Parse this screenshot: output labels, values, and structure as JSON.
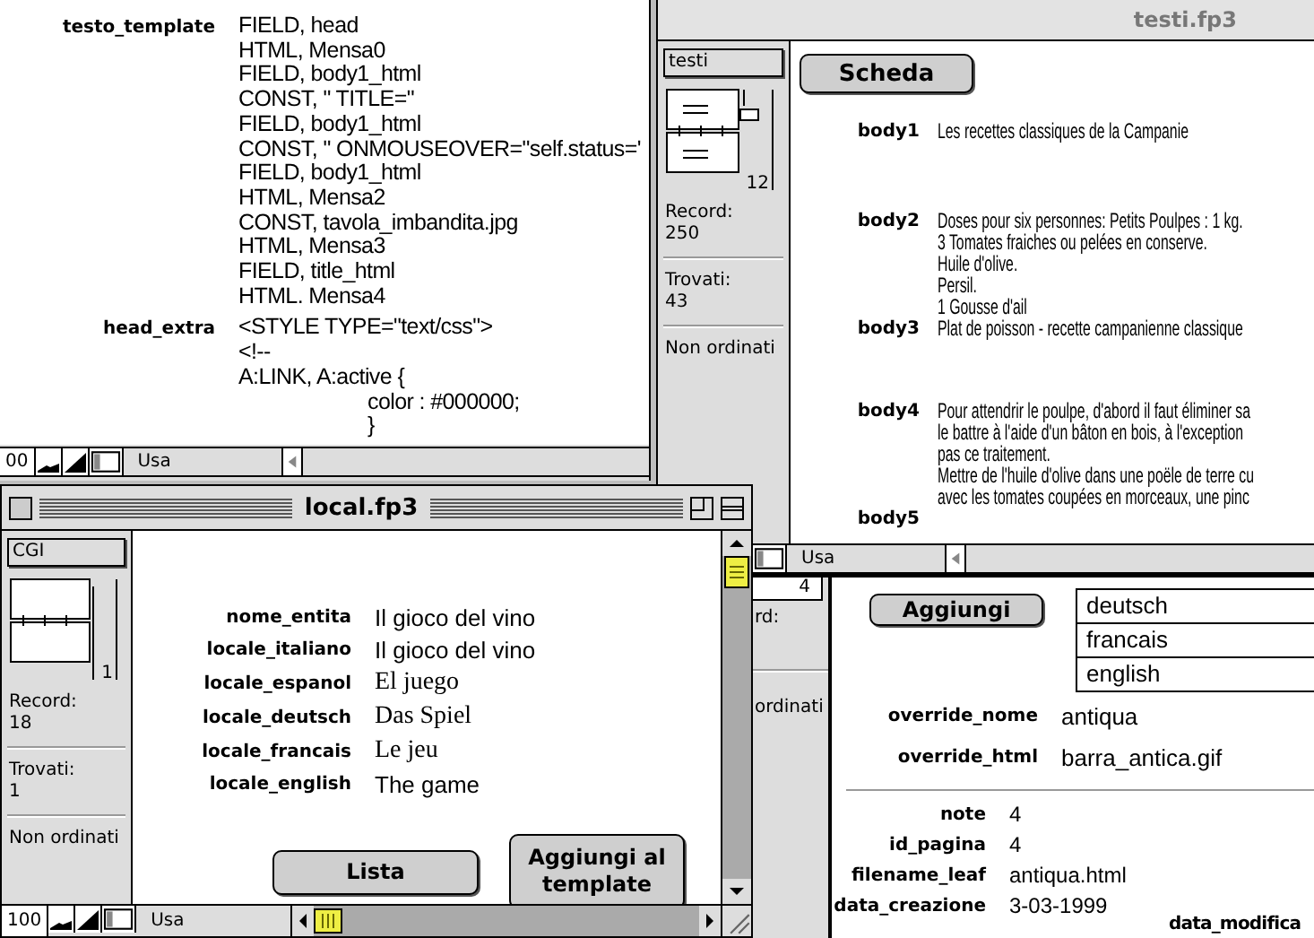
{
  "back_window": {
    "rows": [
      {
        "label": "testo_template",
        "lines": [
          {
            "text": "FIELD, head",
            "kind": "plain"
          },
          {
            "text": "HTML, Mensa0",
            "kind": "plain"
          },
          {
            "text": "FIELD, body1_html",
            "kind": "plain"
          },
          {
            "text": "CONST, \" TITLE=\"",
            "kind": "plain"
          },
          {
            "text": "FIELD, body1_html",
            "kind": "plain"
          },
          {
            "text": "CONST, \" ONMOUSEOVER=\"self.status='",
            "kind": "plain"
          },
          {
            "text": "FIELD, body1_html",
            "kind": "plain"
          },
          {
            "text": "HTML, Mensa2",
            "kind": "plain"
          },
          {
            "text": "CONST, tavola_imbandita.jpg",
            "kind": "plain"
          },
          {
            "text": "HTML, Mensa3",
            "kind": "plain"
          },
          {
            "text": "FIELD, title_html",
            "kind": "plain"
          },
          {
            "text": "HTML. Mensa4",
            "kind": "plain"
          }
        ]
      },
      {
        "label": "head_extra",
        "lines": [
          {
            "text": "<STYLE TYPE=\"text/css\">",
            "kind": "plain"
          },
          {
            "text": "<!--",
            "kind": "plain"
          },
          {
            "text": "A:LINK, A:active {",
            "kind": "plain"
          },
          {
            "text": "color : #000000;",
            "kind": "indented"
          },
          {
            "text": "}",
            "kind": "indented"
          }
        ]
      }
    ],
    "status_bar": {
      "zoom": "00",
      "mode": "Usa"
    }
  },
  "testi_window": {
    "title": "testi.fp3",
    "sidebar": {
      "layout": "testi",
      "page": "12",
      "record_label": "Record:",
      "record": "250",
      "found_label": "Trovati:",
      "found": "43",
      "sort": "Non ordinati"
    },
    "button": "Scheda",
    "rows": [
      {
        "label": "body1",
        "lines": [
          "Les recettes classiques de la Campanie"
        ]
      },
      {
        "label": "body2",
        "lines": [
          "Doses pour six personnes: Petits Poulpes : 1 kg.",
          "3 Tomates fraiches ou pelées en conserve.",
          "Huile d'olive.",
          "Persil.",
          "1 Gousse d'ail"
        ]
      },
      {
        "label": "body3",
        "lines": [
          "Plat de poisson - recette campanienne classique"
        ]
      },
      {
        "label": "body4",
        "lines": [
          "Pour attendrir le poulpe, d'abord il faut éliminer sa",
          "le battre à l'aide d'un bâton en bois, à l'exception",
          "pas ce traitement.",
          "Mettre de l'huile d'olive dans une poële de terre cu",
          "avec les tomates coupées en morceaux, une pinc"
        ]
      },
      {
        "label": "body5"
      }
    ],
    "status_bar": {
      "mode": "Usa"
    }
  },
  "third_window": {
    "sidebar": {
      "page": "4",
      "record_label": "rd:",
      "sort": "ordinati"
    },
    "button": "Aggiungi",
    "list": [
      "deutsch",
      "francais",
      "english"
    ],
    "override_rows": [
      {
        "label": "override_nome",
        "value": "antiqua"
      },
      {
        "label": "override_html",
        "value": "barra_antica.gif"
      }
    ],
    "info_rows": [
      {
        "label": "note",
        "value": "4"
      },
      {
        "label": "id_pagina",
        "value": "4"
      },
      {
        "label": "filename_leaf",
        "value": "antiqua.html"
      },
      {
        "label": "data_creazione",
        "value": "3-03-1999"
      }
    ],
    "extra_label": "data_modifica"
  },
  "local_window": {
    "title": "local.fp3",
    "sidebar": {
      "layout": "CGI",
      "page": "1",
      "record_label": "Record:",
      "record": "18",
      "found_label": "Trovati:",
      "found": "1",
      "sort": "Non ordinati"
    },
    "rows": [
      {
        "label": "nome_entita",
        "value": "Il gioco del vino",
        "kind": "sans"
      },
      {
        "label": "locale_italiano",
        "value": "Il gioco del vino",
        "kind": "sans"
      },
      {
        "label": "locale_espanol",
        "value": "El juego",
        "kind": "serif"
      },
      {
        "label": "locale_deutsch",
        "value": "Das Spiel",
        "kind": "serif"
      },
      {
        "label": "locale_francais",
        "value": "Le jeu",
        "kind": "serif"
      },
      {
        "label": "locale_english",
        "value": "The game",
        "kind": "sans"
      }
    ],
    "buttons": [
      "Lista",
      "Aggiungi al template"
    ],
    "status_bar": {
      "zoom": "100",
      "mode": "Usa"
    }
  }
}
